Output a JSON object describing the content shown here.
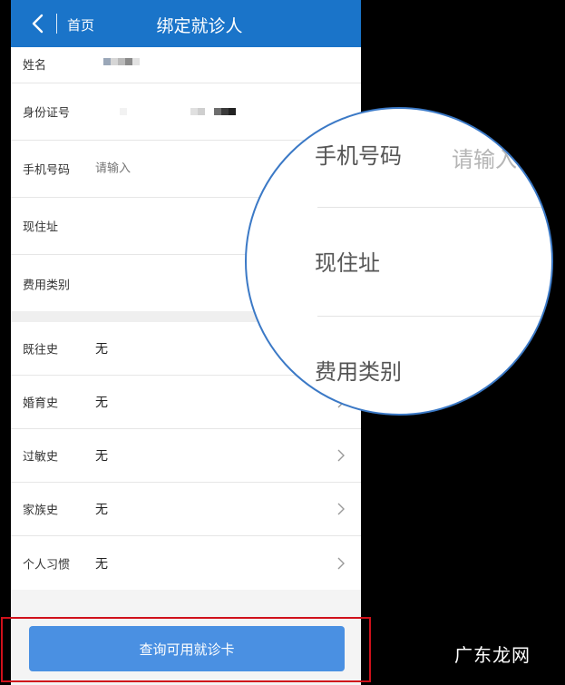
{
  "navbar": {
    "home_label": "首页",
    "title": "绑定就诊人",
    "bg_color": "#1a74c9"
  },
  "form": {
    "name_label": "姓名",
    "id_label": "身份证号",
    "phone_label": "手机号码",
    "phone_placeholder": "请输入",
    "address_label": "现住址",
    "fee_label": "费用类别"
  },
  "history": [
    {
      "label": "既往史",
      "value": "无"
    },
    {
      "label": "婚育史",
      "value": "无"
    },
    {
      "label": "过敏史",
      "value": "无"
    },
    {
      "label": "家族史",
      "value": "无"
    },
    {
      "label": "个人习惯",
      "value": "无"
    }
  ],
  "query_button": {
    "label": "查询可用就诊卡",
    "color": "#4a90e2"
  },
  "magnifier": {
    "phone_label": "手机号码",
    "phone_placeholder": "请输入",
    "address_label": "现住址",
    "fee_label": "费用类别"
  },
  "watermark": "广东龙网",
  "highlight_color": "#d0111b"
}
